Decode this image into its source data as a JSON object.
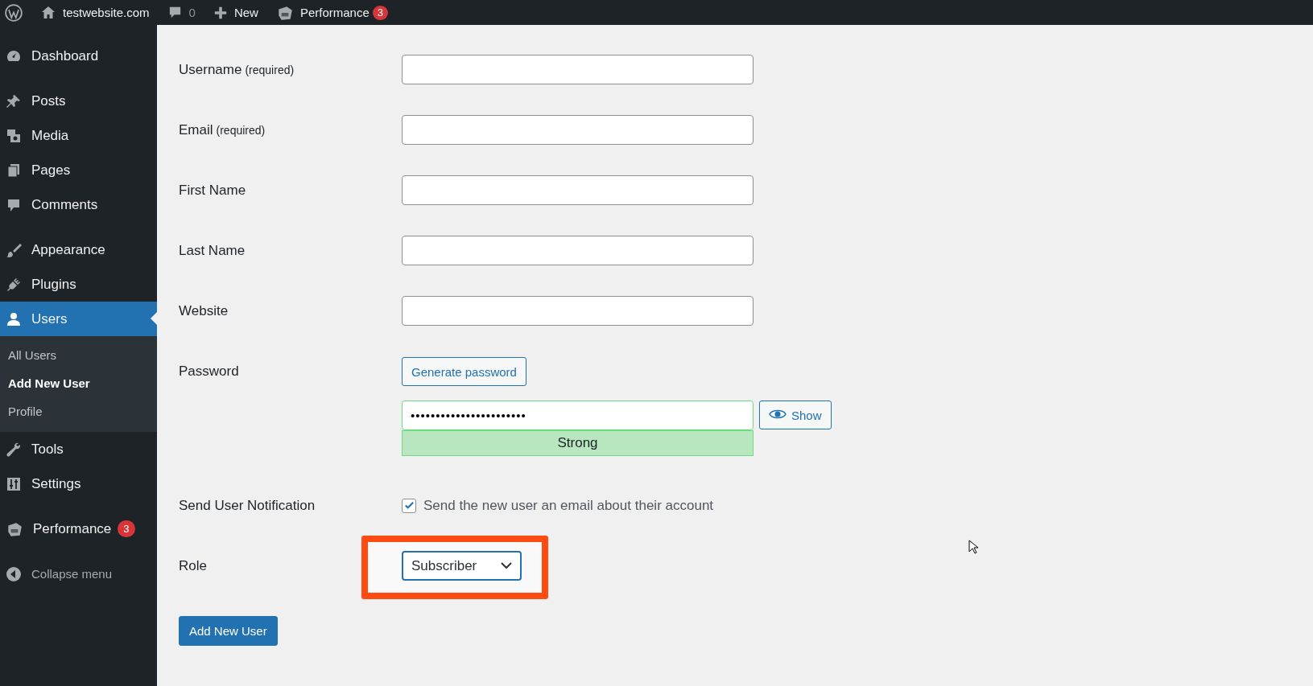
{
  "admin_bar": {
    "site": "testwebsite.com",
    "comments": "0",
    "new": "New",
    "performance": "Performance",
    "performance_badge": "3"
  },
  "sidebar": {
    "groups": [
      [
        {
          "label": "Dashboard",
          "selected": false
        }
      ],
      [
        {
          "label": "Posts",
          "selected": false
        },
        {
          "label": "Media",
          "selected": false
        },
        {
          "label": "Pages",
          "selected": false
        },
        {
          "label": "Comments",
          "selected": false
        }
      ],
      [
        {
          "label": "Appearance",
          "selected": false
        },
        {
          "label": "Plugins",
          "selected": false
        },
        {
          "label": "Users",
          "selected": true,
          "submenu": [
            {
              "label": "All Users",
              "selected": false
            },
            {
              "label": "Add New User",
              "selected": true
            },
            {
              "label": "Profile",
              "selected": false
            }
          ]
        },
        {
          "label": "Tools",
          "selected": false
        },
        {
          "label": "Settings",
          "selected": false
        }
      ],
      [
        {
          "label": "Performance",
          "selected": false,
          "badge": "3"
        }
      ]
    ],
    "collapse": "Collapse menu"
  },
  "form": {
    "rows": [
      {
        "kind": "text",
        "label": "Username",
        "note": "(required)",
        "value": ""
      },
      {
        "kind": "text",
        "label": "Email",
        "note": "(required)",
        "value": ""
      },
      {
        "kind": "text",
        "label": "First Name",
        "value": ""
      },
      {
        "kind": "text",
        "label": "Last Name",
        "value": ""
      },
      {
        "kind": "text",
        "label": "Website",
        "value": ""
      },
      {
        "kind": "password",
        "label": "Password",
        "generate": "Generate password",
        "value": "•••••••••••••••••••••••",
        "show": "Show",
        "strength": "Strong"
      },
      {
        "kind": "checkbox",
        "label": "Send User Notification",
        "checked": true,
        "text": "Send the new user an email about their account"
      },
      {
        "kind": "select",
        "label": "Role",
        "value": "Subscriber",
        "highlighted": true
      }
    ],
    "submit": "Add New User"
  }
}
